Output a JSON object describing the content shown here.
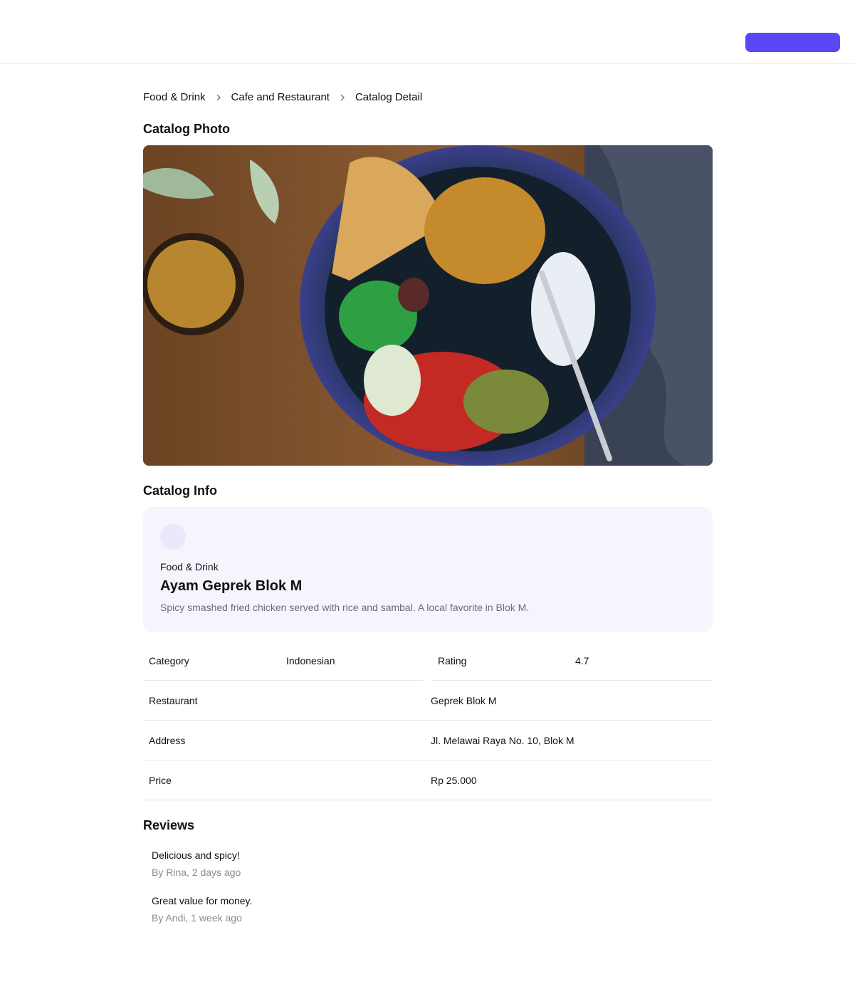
{
  "breadcrumb": {
    "items": [
      "Food & Drink",
      "Cafe and Restaurant",
      "Catalog Detail"
    ]
  },
  "sections": {
    "photo_title": "Catalog Photo",
    "info_title": "Catalog Info",
    "reviews_title": "Reviews"
  },
  "catalog": {
    "category_label": "Food & Drink",
    "name": "Ayam Geprek Blok M",
    "description": "Spicy smashed fried chicken served with rice and sambal. A local favorite in Blok M."
  },
  "details": {
    "category_label": "Category",
    "category_value": "Indonesian",
    "rating_label": "Rating",
    "rating_value": "4.7",
    "restaurant_label": "Restaurant",
    "restaurant_value": "Geprek Blok M",
    "address_label": "Address",
    "address_value": "Jl. Melawai Raya No. 10, Blok M",
    "price_label": "Price",
    "price_value": "Rp 25.000"
  },
  "reviews": [
    {
      "text": "Delicious and spicy!",
      "meta": "By Rina, 2 days ago"
    },
    {
      "text": "Great value for money.",
      "meta": "By Andi, 1 week ago"
    }
  ],
  "colors": {
    "accent": "#5c47f7",
    "card_bg": "#f6f5fe",
    "avatar_bg": "#ebe8fc",
    "muted_text": "#6b6b78"
  }
}
